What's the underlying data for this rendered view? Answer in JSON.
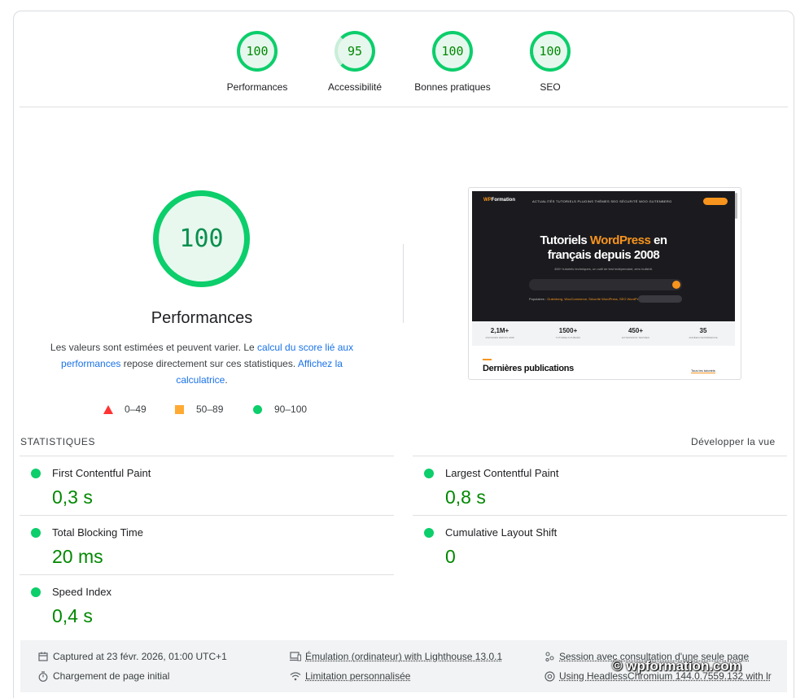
{
  "gauges": [
    {
      "score": "100",
      "label": "Performances"
    },
    {
      "score": "95",
      "label": "Accessibilité"
    },
    {
      "score": "100",
      "label": "Bonnes pratiques"
    },
    {
      "score": "100",
      "label": "SEO"
    }
  ],
  "main": {
    "score": "100",
    "title": "Performances",
    "desc_prefix": "Les valeurs sont estimées et peuvent varier. Le ",
    "desc_link1": "calcul du score lié aux performances",
    "desc_middle": " repose directement sur ces statistiques. ",
    "desc_link2": "Affichez la calculatrice",
    "desc_suffix": "."
  },
  "legend": {
    "fail": "0–49",
    "average": "50–89",
    "pass": "90–100"
  },
  "thumbnail": {
    "logo_prefix": "WP",
    "logo_suffix": "Formation",
    "nav": "ACTUALITÉS   TUTORIELS   PLUGINS   THÈMES   SEO   SÉCURITÉ   WOO   GUTENBERG",
    "hero_line1_prefix": "Tutoriels ",
    "hero_line1_accent": "WordPress",
    "hero_line1_suffix": " en",
    "hero_line2": "français depuis 2008",
    "hero_sub": "450+ tutoriels techniques, un outil de test indépendant, zéro bullshit.",
    "popular_label": "Populaires : ",
    "popular_items": "Gutenberg, WooCommerce, Sécurité WordPress, SEO WordPress",
    "stats": [
      {
        "value": "2,1M+",
        "label": "VISITEURS DEPUIS 2008"
      },
      {
        "value": "1500+",
        "label": "TUTORIELS PUBLIÉS"
      },
      {
        "value": "450+",
        "label": "EXTENSIONS TESTÉES"
      },
      {
        "value": "35",
        "label": "ANNÉES D'EXPÉRIENCE"
      }
    ],
    "section_title": "Dernières publications",
    "all_link": "Tous les tutoriels"
  },
  "statistics": {
    "heading": "STATISTIQUES",
    "expand": "Développer la vue",
    "metrics": [
      {
        "name": "First Contentful Paint",
        "value": "0,3 s"
      },
      {
        "name": "Largest Contentful Paint",
        "value": "0,8 s"
      },
      {
        "name": "Total Blocking Time",
        "value": "20 ms"
      },
      {
        "name": "Cumulative Layout Shift",
        "value": "0"
      },
      {
        "name": "Speed Index",
        "value": "0,4 s"
      }
    ]
  },
  "runtime": {
    "captured": "Captured at 23 févr. 2026, 01:00 UTC+1",
    "load": "Chargement de page initial",
    "emulation": "Émulation (ordinateur) with Lighthouse 13.0.1",
    "throttling": "Limitation personnalisée",
    "session": "Session avec consultation d'une seule page",
    "browser": "Using HeadlessChromium 144.0.7559.132 with lr"
  },
  "watermark": "© wpformation.com",
  "colors": {
    "pass": "#0cce6b",
    "average": "#ffaa33",
    "fail": "#ff3333",
    "link": "#1a73e8",
    "value_text": "#008800"
  }
}
